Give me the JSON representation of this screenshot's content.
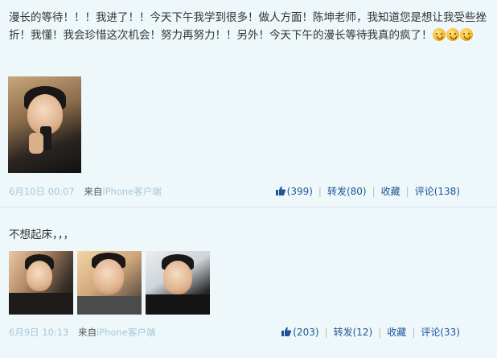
{
  "posts": [
    {
      "text": "漫长的等待！！！我进了！！今天下午我学到很多！做人方面！陈坤老师，我知道您是想让我受些挫折！我懂！我会珍惜这次机会！努力再努力！！另外！今天下午的漫长等待我真的疯了！",
      "emoji_count": 3,
      "time": "6月10日 00:07",
      "from_label": "来自",
      "client": "iPhone客户端",
      "likes": "(399)",
      "repost": "转发(80)",
      "favorite": "收藏",
      "comment": "评论(138)"
    },
    {
      "text": "不想起床，，，",
      "time": "6月9日 10:13",
      "from_label": "来自",
      "client": "iPhone客户端",
      "likes": "(203)",
      "repost": "转发(12)",
      "favorite": "收藏",
      "comment": "评论(33)"
    }
  ],
  "colors": {
    "background": "#eef8fb",
    "link": "#1e5494",
    "muted": "#a8c7d8"
  },
  "icons": {
    "like": "thumbs-up-icon",
    "emoji": "yawning-face-icon"
  }
}
